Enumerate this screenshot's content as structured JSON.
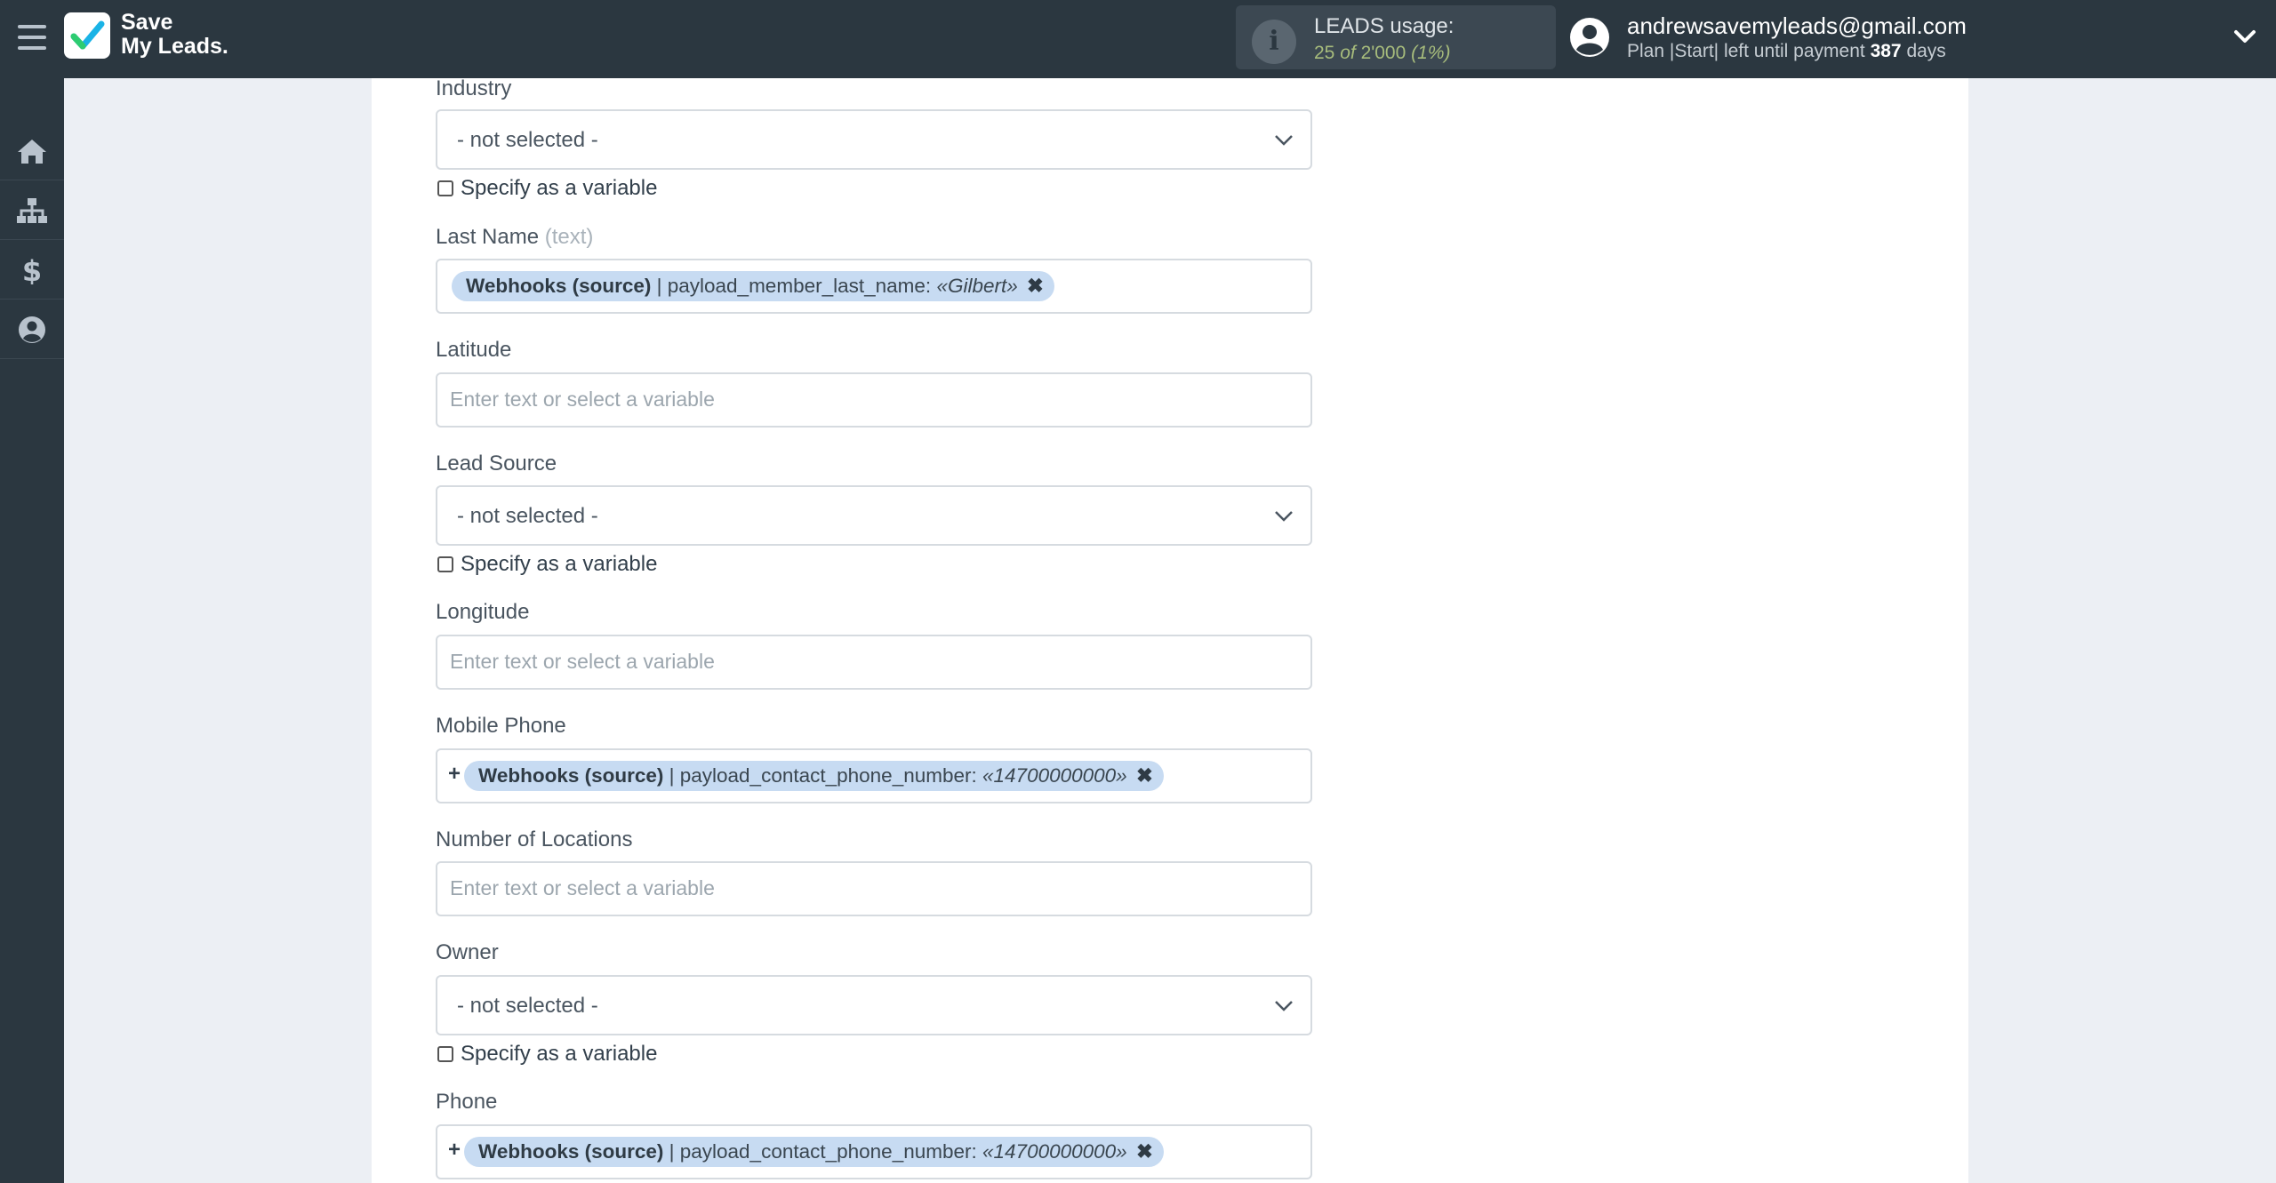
{
  "header": {
    "brand_line1": "Save",
    "brand_line2": "My Leads.",
    "leads": {
      "title": "LEADS usage:",
      "used": "25",
      "of_text": "of",
      "limit": "2'000",
      "percent": "(1%)"
    },
    "user": {
      "email": "andrewsavemyleads@gmail.com",
      "plan_prefix": "Plan |Start| left until payment",
      "days_value": "387",
      "days_suffix": "days"
    }
  },
  "sidebar": {
    "items": [
      {
        "icon": "home-icon"
      },
      {
        "icon": "sitemap-icon"
      },
      {
        "icon": "dollar-icon"
      },
      {
        "icon": "user-circle-icon"
      }
    ]
  },
  "form": {
    "industry": {
      "label": "Industry",
      "value": "- not selected -",
      "checkbox": "Specify as a variable"
    },
    "last_name": {
      "label": "Last Name",
      "hint": "(text)",
      "tag_source": "Webhooks (source)",
      "tag_field": "| payload_member_last_name:",
      "tag_value": "«Gilbert»",
      "tag_remove": "✖"
    },
    "latitude": {
      "label": "Latitude",
      "placeholder": "Enter text or select a variable"
    },
    "lead_source": {
      "label": "Lead Source",
      "value": "- not selected -",
      "checkbox": "Specify as a variable"
    },
    "longitude": {
      "label": "Longitude",
      "placeholder": "Enter text or select a variable"
    },
    "mobile_phone": {
      "label": "Mobile Phone",
      "prefix": "+",
      "tag_source": "Webhooks (source)",
      "tag_field": "| payload_contact_phone_number:",
      "tag_value": "«14700000000»",
      "tag_remove": "✖"
    },
    "number_of_locations": {
      "label": "Number of Locations",
      "placeholder": "Enter text or select a variable"
    },
    "owner": {
      "label": "Owner",
      "value": "- not selected -",
      "checkbox": "Specify as a variable"
    },
    "phone": {
      "label": "Phone",
      "prefix": "+",
      "tag_source": "Webhooks (source)",
      "tag_field": "| payload_contact_phone_number:",
      "tag_value": "«14700000000»",
      "tag_remove": "✖"
    }
  },
  "colors": {
    "topbar": "#2b3740",
    "accent_green": "#a7bc7c",
    "tag_bg": "#c7dbf2",
    "panel_bg": "#ffffff"
  }
}
